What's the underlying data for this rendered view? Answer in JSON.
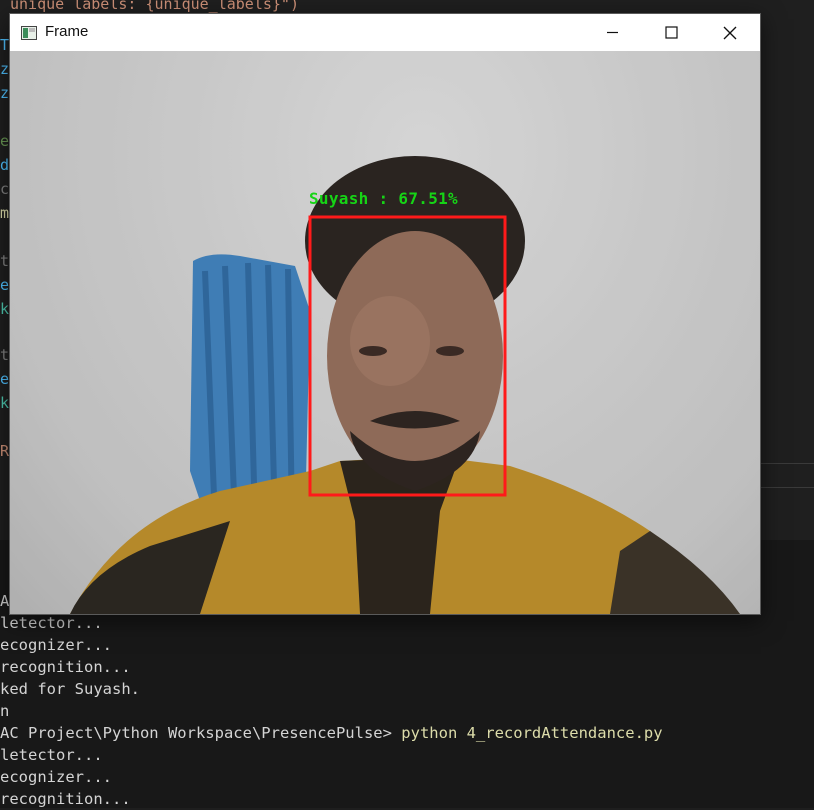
{
  "editor": {
    "top_line": "unique labels: {unique_labels}\")"
  },
  "window": {
    "title": "Frame"
  },
  "overlay": {
    "label": "Suyash : 67.51%",
    "box_color": "#ff1a1a",
    "label_color": "#16d416"
  },
  "terminal": {
    "lines": [
      "A",
      "letector...",
      "ecognizer...",
      "recognition...",
      "ked for Suyash.",
      "n",
      "AC Project\\Python Workspace\\PresencePulse>",
      "letector...",
      "ecognizer...",
      "recognition..."
    ],
    "command": "python 4_recordAttendance.py"
  }
}
